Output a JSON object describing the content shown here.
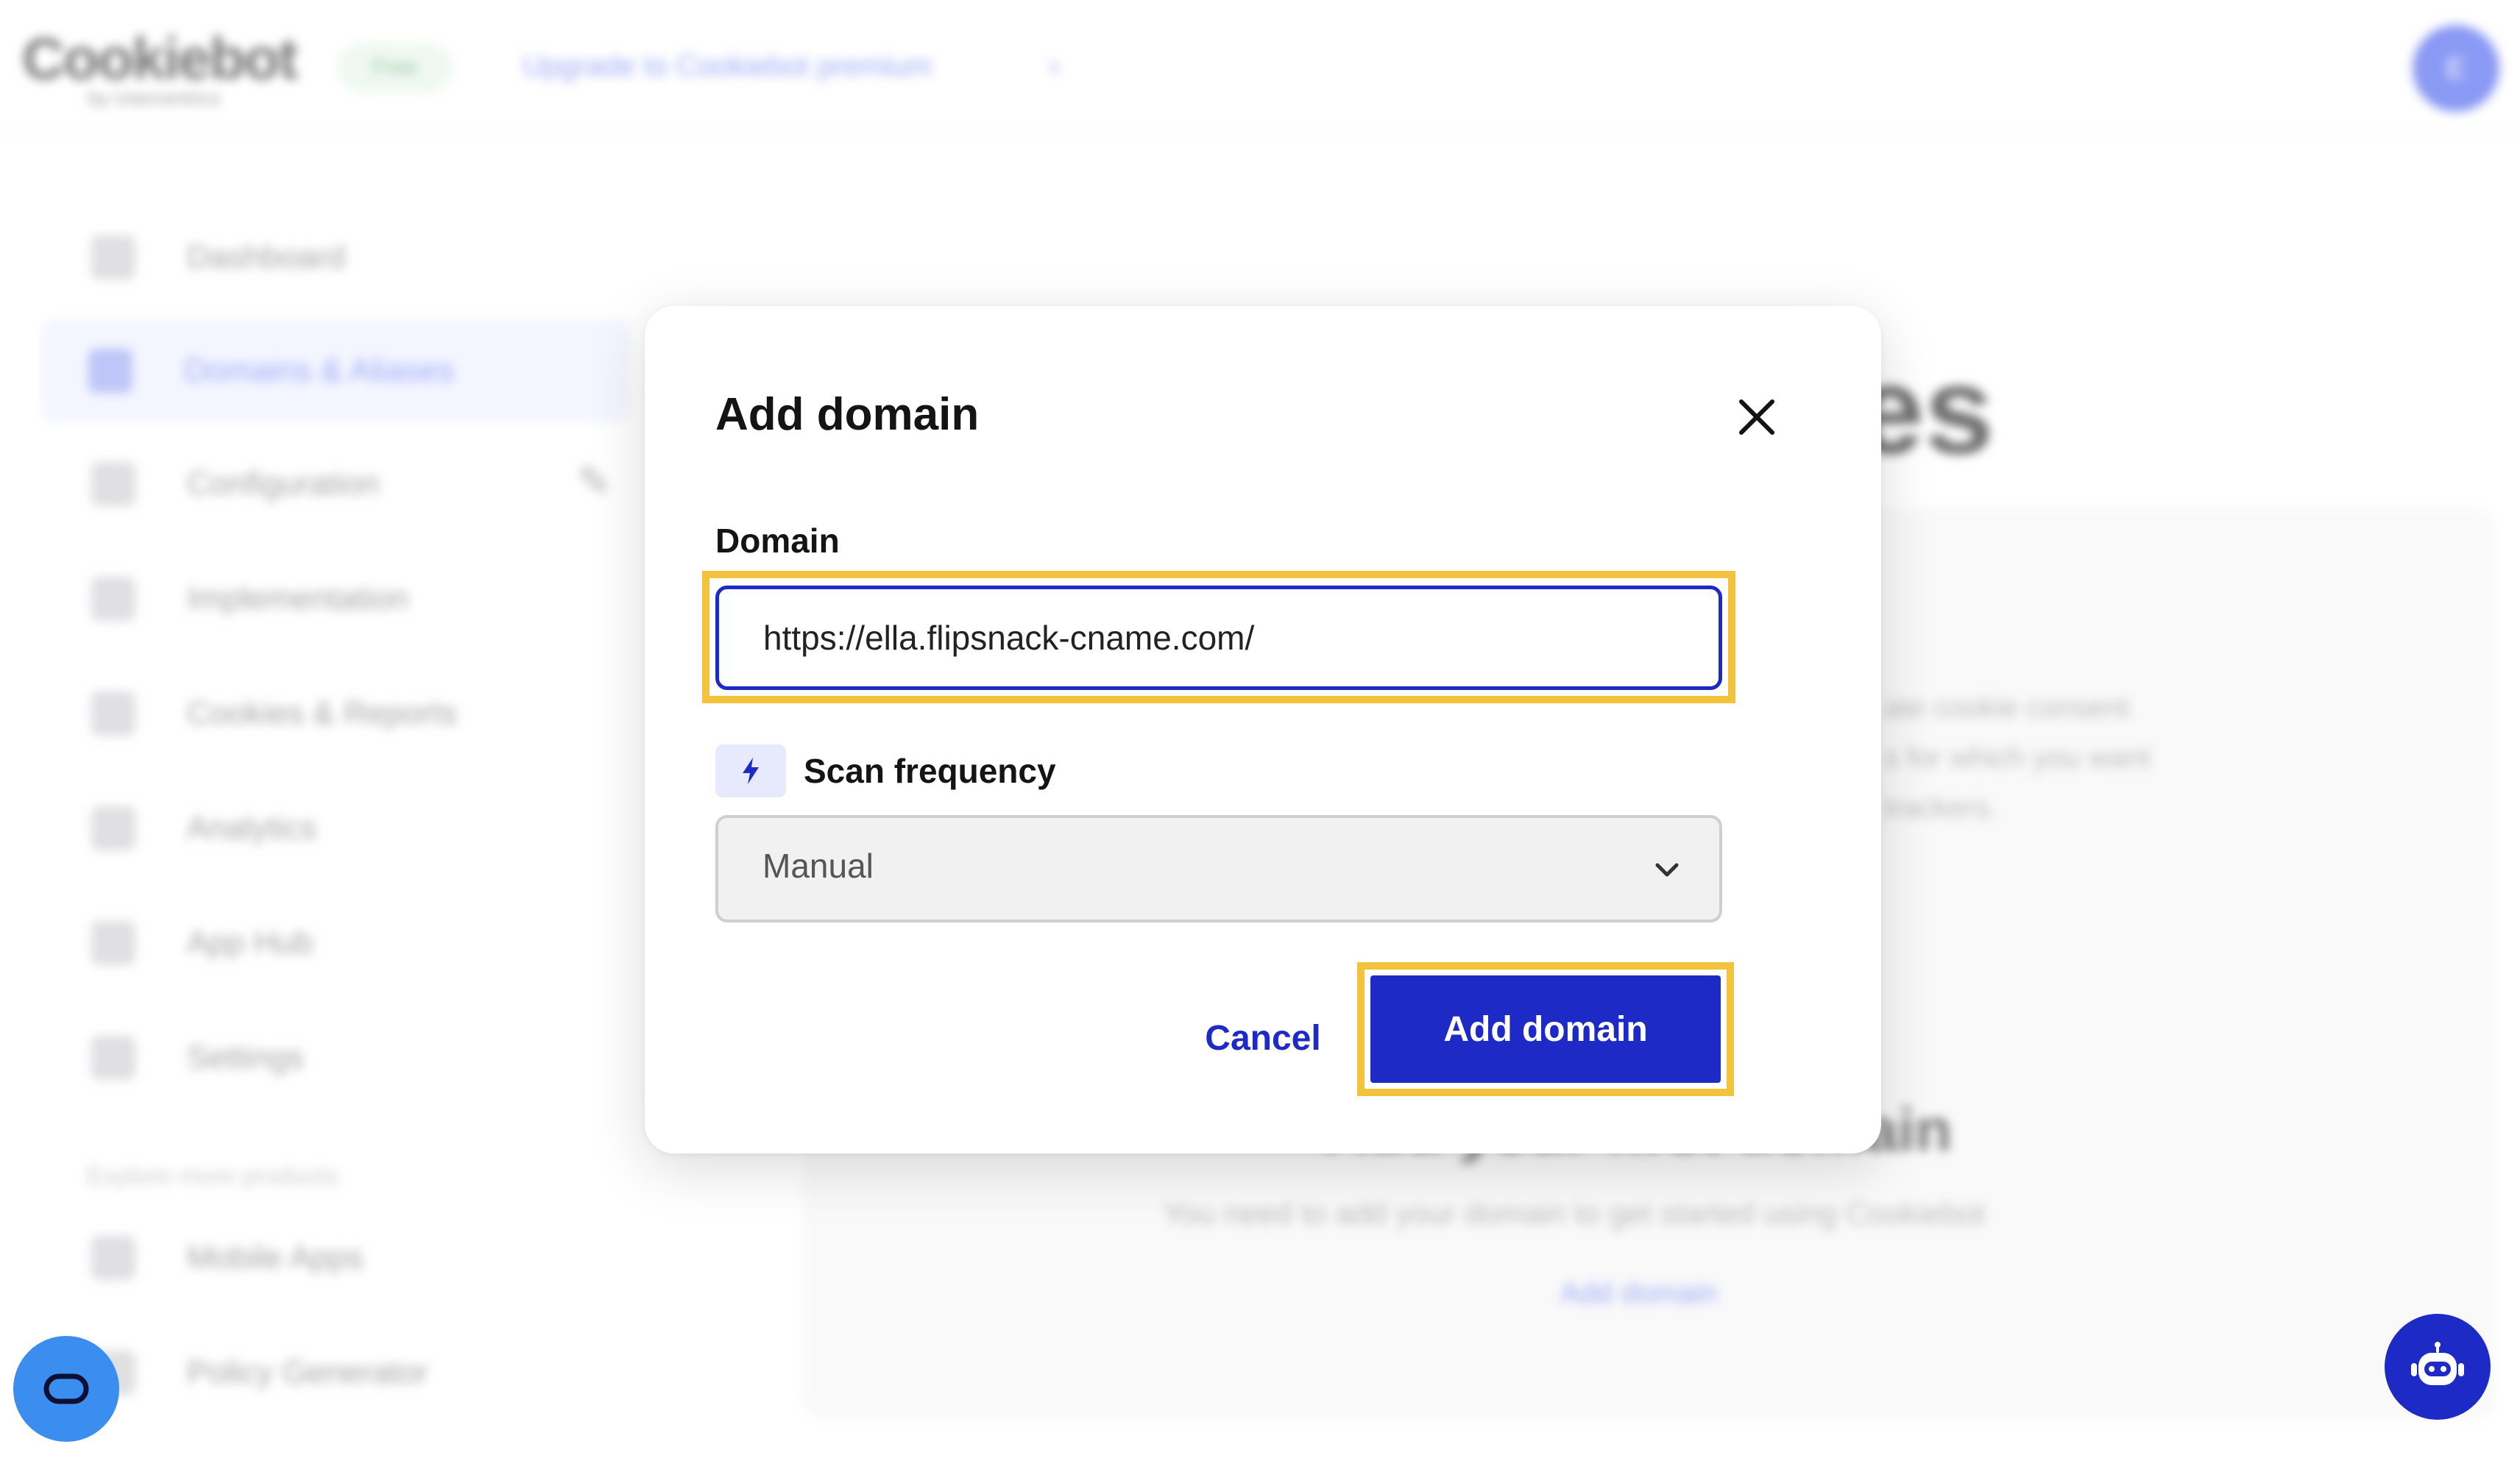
{
  "background": {
    "logo_text": "Cookiebot",
    "logo_sub": "by Usercentrics",
    "plan_badge": "Free",
    "upgrade_link": "Upgrade to Cookiebot premium",
    "upgrade_chevron": "›",
    "avatar_initial": "E",
    "nav": [
      {
        "label": "Dashboard"
      },
      {
        "label": "Domains & Aliases"
      },
      {
        "label": "Configuration"
      },
      {
        "label": "Implementation"
      },
      {
        "label": "Cookies & Reports"
      },
      {
        "label": "Analytics"
      },
      {
        "label": "App Hub"
      },
      {
        "label": "Settings"
      }
    ],
    "explore_label": "Explore more products",
    "explore_items": [
      {
        "label": "Mobile Apps"
      },
      {
        "label": "Policy Generator"
      }
    ],
    "page_heading_fragment": "es",
    "card_text_lines": [
      "ate cookie consent",
      "s for which you want",
      "trackers."
    ],
    "empty_title": "Add your first domain",
    "empty_desc": "You need to add your domain to get started using Cookiebot",
    "empty_link": "Add domain"
  },
  "modal": {
    "title": "Add domain",
    "domain_label": "Domain",
    "domain_value": "https://ella.flipsnack-cname.com/",
    "scan_label": "Scan frequency",
    "scan_value": "Manual",
    "cancel_label": "Cancel",
    "submit_label": "Add domain"
  },
  "icons": {
    "close": "close-icon",
    "scan": "lightning-icon",
    "select": "chevron-down-icon",
    "consent": "consent-icon",
    "chat": "chatbot-icon"
  },
  "colors": {
    "primary": "#1e2ac6",
    "highlight": "#f3c33c",
    "consent_fab": "#3b8ef0",
    "chat_fab": "#1e2ac6"
  }
}
